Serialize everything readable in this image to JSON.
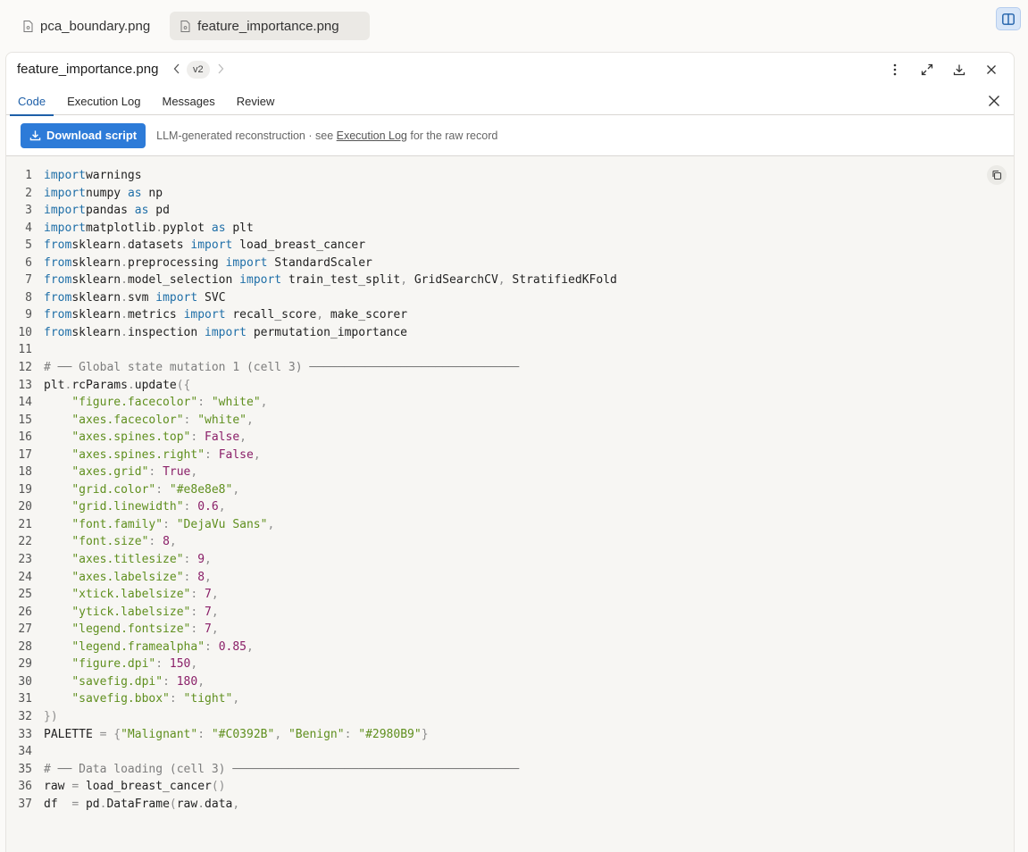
{
  "file_tabs": [
    {
      "name": "pca_boundary.png",
      "active": false
    },
    {
      "name": "feature_importance.png",
      "active": true
    }
  ],
  "panel": {
    "title": "feature_importance.png",
    "version": "v2",
    "tabs": [
      "Code",
      "Execution Log",
      "Messages",
      "Review"
    ],
    "active_tab": "Code"
  },
  "action_bar": {
    "download_label": "Download script",
    "note_prefix": "LLM-generated reconstruction · see",
    "note_link": "Execution Log",
    "note_suffix": "for the raw record"
  },
  "code_lines": [
    [
      [
        "kw",
        "import"
      ],
      [
        "",
        "warnings"
      ]
    ],
    [
      [
        "kw",
        "import"
      ],
      [
        "",
        "numpy "
      ],
      [
        "kw",
        "as"
      ],
      [
        "",
        " np"
      ]
    ],
    [
      [
        "kw",
        "import"
      ],
      [
        "",
        "pandas "
      ],
      [
        "kw",
        "as"
      ],
      [
        "",
        " pd"
      ]
    ],
    [
      [
        "kw",
        "import"
      ],
      [
        "",
        "matplotlib"
      ],
      [
        "pn",
        "."
      ],
      [
        "",
        "pyplot "
      ],
      [
        "kw",
        "as"
      ],
      [
        "",
        " plt"
      ]
    ],
    [
      [
        "kw",
        "from"
      ],
      [
        "",
        "sklearn"
      ],
      [
        "pn",
        "."
      ],
      [
        "",
        "datasets "
      ],
      [
        "kw",
        "import"
      ],
      [
        "",
        " load_breast_cancer"
      ]
    ],
    [
      [
        "kw",
        "from"
      ],
      [
        "",
        "sklearn"
      ],
      [
        "pn",
        "."
      ],
      [
        "",
        "preprocessing "
      ],
      [
        "kw",
        "import"
      ],
      [
        "",
        " StandardScaler"
      ]
    ],
    [
      [
        "kw",
        "from"
      ],
      [
        "",
        "sklearn"
      ],
      [
        "pn",
        "."
      ],
      [
        "",
        "model_selection "
      ],
      [
        "kw",
        "import"
      ],
      [
        "",
        " train_test_split"
      ],
      [
        "pn",
        ","
      ],
      [
        "",
        " GridSearchCV"
      ],
      [
        "pn",
        ","
      ],
      [
        "",
        " StratifiedKFold"
      ]
    ],
    [
      [
        "kw",
        "from"
      ],
      [
        "",
        "sklearn"
      ],
      [
        "pn",
        "."
      ],
      [
        "",
        "svm "
      ],
      [
        "kw",
        "import"
      ],
      [
        "",
        " SVC"
      ]
    ],
    [
      [
        "kw",
        "from"
      ],
      [
        "",
        "sklearn"
      ],
      [
        "pn",
        "."
      ],
      [
        "",
        "metrics "
      ],
      [
        "kw",
        "import"
      ],
      [
        "",
        " recall_score"
      ],
      [
        "pn",
        ","
      ],
      [
        "",
        " make_scorer"
      ]
    ],
    [
      [
        "kw",
        "from"
      ],
      [
        "",
        "sklearn"
      ],
      [
        "pn",
        "."
      ],
      [
        "",
        "inspection "
      ],
      [
        "kw",
        "import"
      ],
      [
        "",
        " permutation_importance"
      ]
    ],
    [],
    [
      [
        "cm",
        "# ── Global state mutation 1 (cell 3) ──────────────────────────────"
      ]
    ],
    [
      [
        "",
        "plt"
      ],
      [
        "pn",
        "."
      ],
      [
        "",
        "rcParams"
      ],
      [
        "pn",
        "."
      ],
      [
        "",
        "update"
      ],
      [
        "pn",
        "({"
      ]
    ],
    [
      [
        "",
        "    "
      ],
      [
        "str",
        "\"figure.facecolor\""
      ],
      [
        "pn",
        ": "
      ],
      [
        "str",
        "\"white\""
      ],
      [
        "pn",
        ","
      ]
    ],
    [
      [
        "",
        "    "
      ],
      [
        "str",
        "\"axes.facecolor\""
      ],
      [
        "pn",
        ": "
      ],
      [
        "str",
        "\"white\""
      ],
      [
        "pn",
        ","
      ]
    ],
    [
      [
        "",
        "    "
      ],
      [
        "str",
        "\"axes.spines.top\""
      ],
      [
        "pn",
        ": "
      ],
      [
        "num",
        "False"
      ],
      [
        "pn",
        ","
      ]
    ],
    [
      [
        "",
        "    "
      ],
      [
        "str",
        "\"axes.spines.right\""
      ],
      [
        "pn",
        ": "
      ],
      [
        "num",
        "False"
      ],
      [
        "pn",
        ","
      ]
    ],
    [
      [
        "",
        "    "
      ],
      [
        "str",
        "\"axes.grid\""
      ],
      [
        "pn",
        ": "
      ],
      [
        "num",
        "True"
      ],
      [
        "pn",
        ","
      ]
    ],
    [
      [
        "",
        "    "
      ],
      [
        "str",
        "\"grid.color\""
      ],
      [
        "pn",
        ": "
      ],
      [
        "str",
        "\"#e8e8e8\""
      ],
      [
        "pn",
        ","
      ]
    ],
    [
      [
        "",
        "    "
      ],
      [
        "str",
        "\"grid.linewidth\""
      ],
      [
        "pn",
        ": "
      ],
      [
        "num",
        "0.6"
      ],
      [
        "pn",
        ","
      ]
    ],
    [
      [
        "",
        "    "
      ],
      [
        "str",
        "\"font.family\""
      ],
      [
        "pn",
        ": "
      ],
      [
        "str",
        "\"DejaVu Sans\""
      ],
      [
        "pn",
        ","
      ]
    ],
    [
      [
        "",
        "    "
      ],
      [
        "str",
        "\"font.size\""
      ],
      [
        "pn",
        ": "
      ],
      [
        "num",
        "8"
      ],
      [
        "pn",
        ","
      ]
    ],
    [
      [
        "",
        "    "
      ],
      [
        "str",
        "\"axes.titlesize\""
      ],
      [
        "pn",
        ": "
      ],
      [
        "num",
        "9"
      ],
      [
        "pn",
        ","
      ]
    ],
    [
      [
        "",
        "    "
      ],
      [
        "str",
        "\"axes.labelsize\""
      ],
      [
        "pn",
        ": "
      ],
      [
        "num",
        "8"
      ],
      [
        "pn",
        ","
      ]
    ],
    [
      [
        "",
        "    "
      ],
      [
        "str",
        "\"xtick.labelsize\""
      ],
      [
        "pn",
        ": "
      ],
      [
        "num",
        "7"
      ],
      [
        "pn",
        ","
      ]
    ],
    [
      [
        "",
        "    "
      ],
      [
        "str",
        "\"ytick.labelsize\""
      ],
      [
        "pn",
        ": "
      ],
      [
        "num",
        "7"
      ],
      [
        "pn",
        ","
      ]
    ],
    [
      [
        "",
        "    "
      ],
      [
        "str",
        "\"legend.fontsize\""
      ],
      [
        "pn",
        ": "
      ],
      [
        "num",
        "7"
      ],
      [
        "pn",
        ","
      ]
    ],
    [
      [
        "",
        "    "
      ],
      [
        "str",
        "\"legend.framealpha\""
      ],
      [
        "pn",
        ": "
      ],
      [
        "num",
        "0.85"
      ],
      [
        "pn",
        ","
      ]
    ],
    [
      [
        "",
        "    "
      ],
      [
        "str",
        "\"figure.dpi\""
      ],
      [
        "pn",
        ": "
      ],
      [
        "num",
        "150"
      ],
      [
        "pn",
        ","
      ]
    ],
    [
      [
        "",
        "    "
      ],
      [
        "str",
        "\"savefig.dpi\""
      ],
      [
        "pn",
        ": "
      ],
      [
        "num",
        "180"
      ],
      [
        "pn",
        ","
      ]
    ],
    [
      [
        "",
        "    "
      ],
      [
        "str",
        "\"savefig.bbox\""
      ],
      [
        "pn",
        ": "
      ],
      [
        "str",
        "\"tight\""
      ],
      [
        "pn",
        ","
      ]
    ],
    [
      [
        "pn",
        "})"
      ]
    ],
    [
      [
        "",
        "PALETTE "
      ],
      [
        "pn",
        "= {"
      ],
      [
        "str",
        "\"Malignant\""
      ],
      [
        "pn",
        ": "
      ],
      [
        "str",
        "\"#C0392B\""
      ],
      [
        "pn",
        ", "
      ],
      [
        "str",
        "\"Benign\""
      ],
      [
        "pn",
        ": "
      ],
      [
        "str",
        "\"#2980B9\""
      ],
      [
        "pn",
        "}"
      ]
    ],
    [],
    [
      [
        "cm",
        "# ── Data loading (cell 3) ─────────────────────────────────────────"
      ]
    ],
    [
      [
        "",
        "raw "
      ],
      [
        "pn",
        "="
      ],
      [
        "",
        " load_breast_cancer"
      ],
      [
        "pn",
        "()"
      ]
    ],
    [
      [
        "",
        "df  "
      ],
      [
        "pn",
        "="
      ],
      [
        "",
        " pd"
      ],
      [
        "pn",
        "."
      ],
      [
        "",
        "DataFrame"
      ],
      [
        "pn",
        "("
      ],
      [
        "",
        "raw"
      ],
      [
        "pn",
        "."
      ],
      [
        "",
        "data"
      ],
      [
        "pn",
        ","
      ]
    ]
  ]
}
